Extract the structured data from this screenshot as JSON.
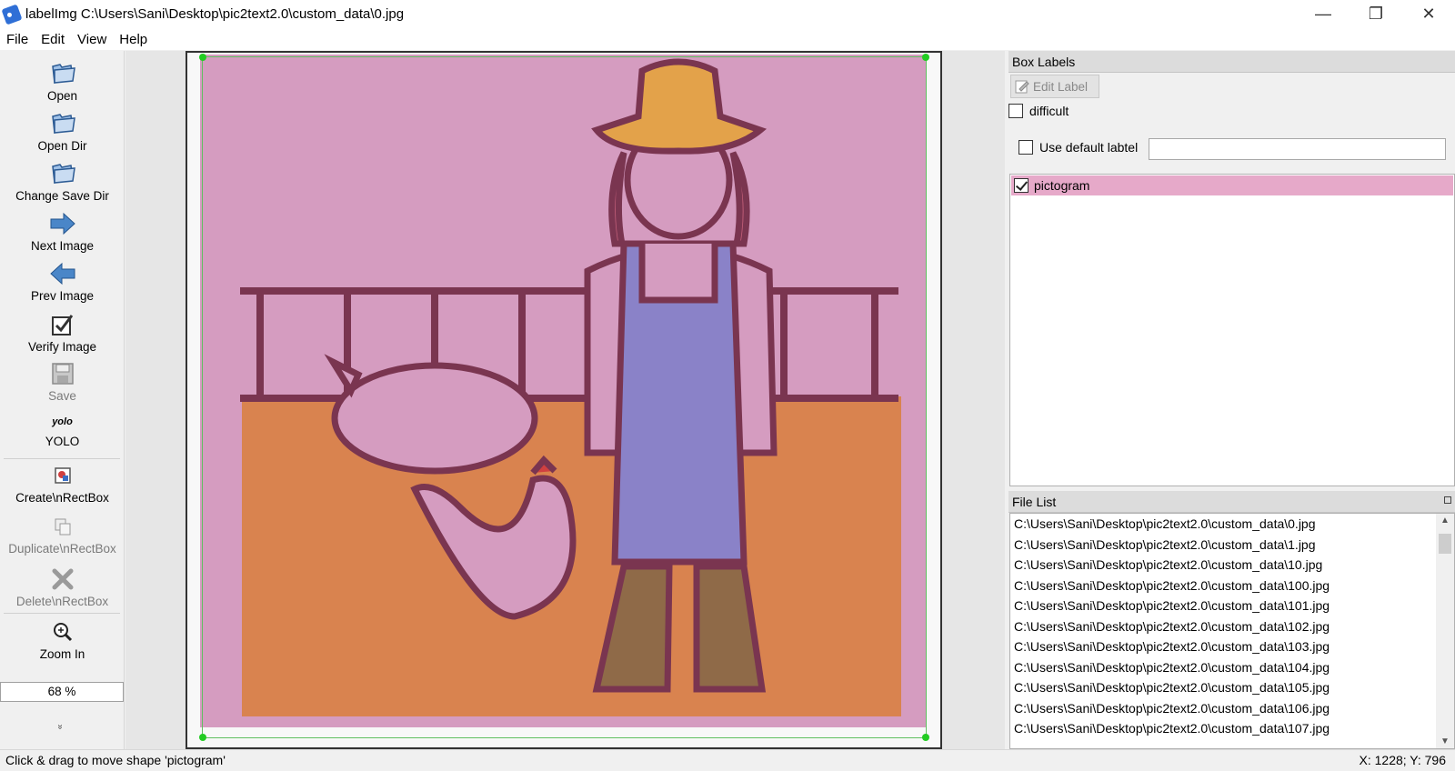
{
  "window": {
    "title": "labelImg C:\\Users\\Sani\\Desktop\\pic2text2.0\\custom_data\\0.jpg",
    "minimize": "—",
    "maximize": "❐",
    "close": "✕"
  },
  "menu": [
    "File",
    "Edit",
    "View",
    "Help"
  ],
  "toolbar": {
    "open": "Open",
    "open_dir": "Open Dir",
    "change_save_dir": "Change Save Dir",
    "next_image": "Next Image",
    "prev_image": "Prev Image",
    "verify_image": "Verify Image",
    "save": "Save",
    "yolo_icon_text": "yolo",
    "yolo": "YOLO",
    "create_rect": "Create\\nRectBox",
    "duplicate_rect": "Duplicate\\nRectBox",
    "delete_rect": "Delete\\nRectBox",
    "zoom_in": "Zoom In",
    "zoom_value": "68 %",
    "more": "»"
  },
  "box_labels": {
    "title": "Box Labels",
    "edit_label": "Edit Label",
    "difficult": "difficult",
    "use_default_label": "Use default labtel",
    "default_label_value": "",
    "labels": [
      {
        "name": "pictogram",
        "checked": true,
        "color": "#e6a9c9"
      }
    ]
  },
  "file_list": {
    "title": "File List",
    "files": [
      "C:\\Users\\Sani\\Desktop\\pic2text2.0\\custom_data\\0.jpg",
      "C:\\Users\\Sani\\Desktop\\pic2text2.0\\custom_data\\1.jpg",
      "C:\\Users\\Sani\\Desktop\\pic2text2.0\\custom_data\\10.jpg",
      "C:\\Users\\Sani\\Desktop\\pic2text2.0\\custom_data\\100.jpg",
      "C:\\Users\\Sani\\Desktop\\pic2text2.0\\custom_data\\101.jpg",
      "C:\\Users\\Sani\\Desktop\\pic2text2.0\\custom_data\\102.jpg",
      "C:\\Users\\Sani\\Desktop\\pic2text2.0\\custom_data\\103.jpg",
      "C:\\Users\\Sani\\Desktop\\pic2text2.0\\custom_data\\104.jpg",
      "C:\\Users\\Sani\\Desktop\\pic2text2.0\\custom_data\\105.jpg",
      "C:\\Users\\Sani\\Desktop\\pic2text2.0\\custom_data\\106.jpg",
      "C:\\Users\\Sani\\Desktop\\pic2text2.0\\custom_data\\107.jpg"
    ]
  },
  "status": {
    "message": "Click & drag to move shape 'pictogram'",
    "coords": "X: 1228; Y: 796"
  },
  "colors": {
    "pictogram_fill": "#d59cc0",
    "floor": "#d9834f",
    "handle": "#22cc22"
  }
}
